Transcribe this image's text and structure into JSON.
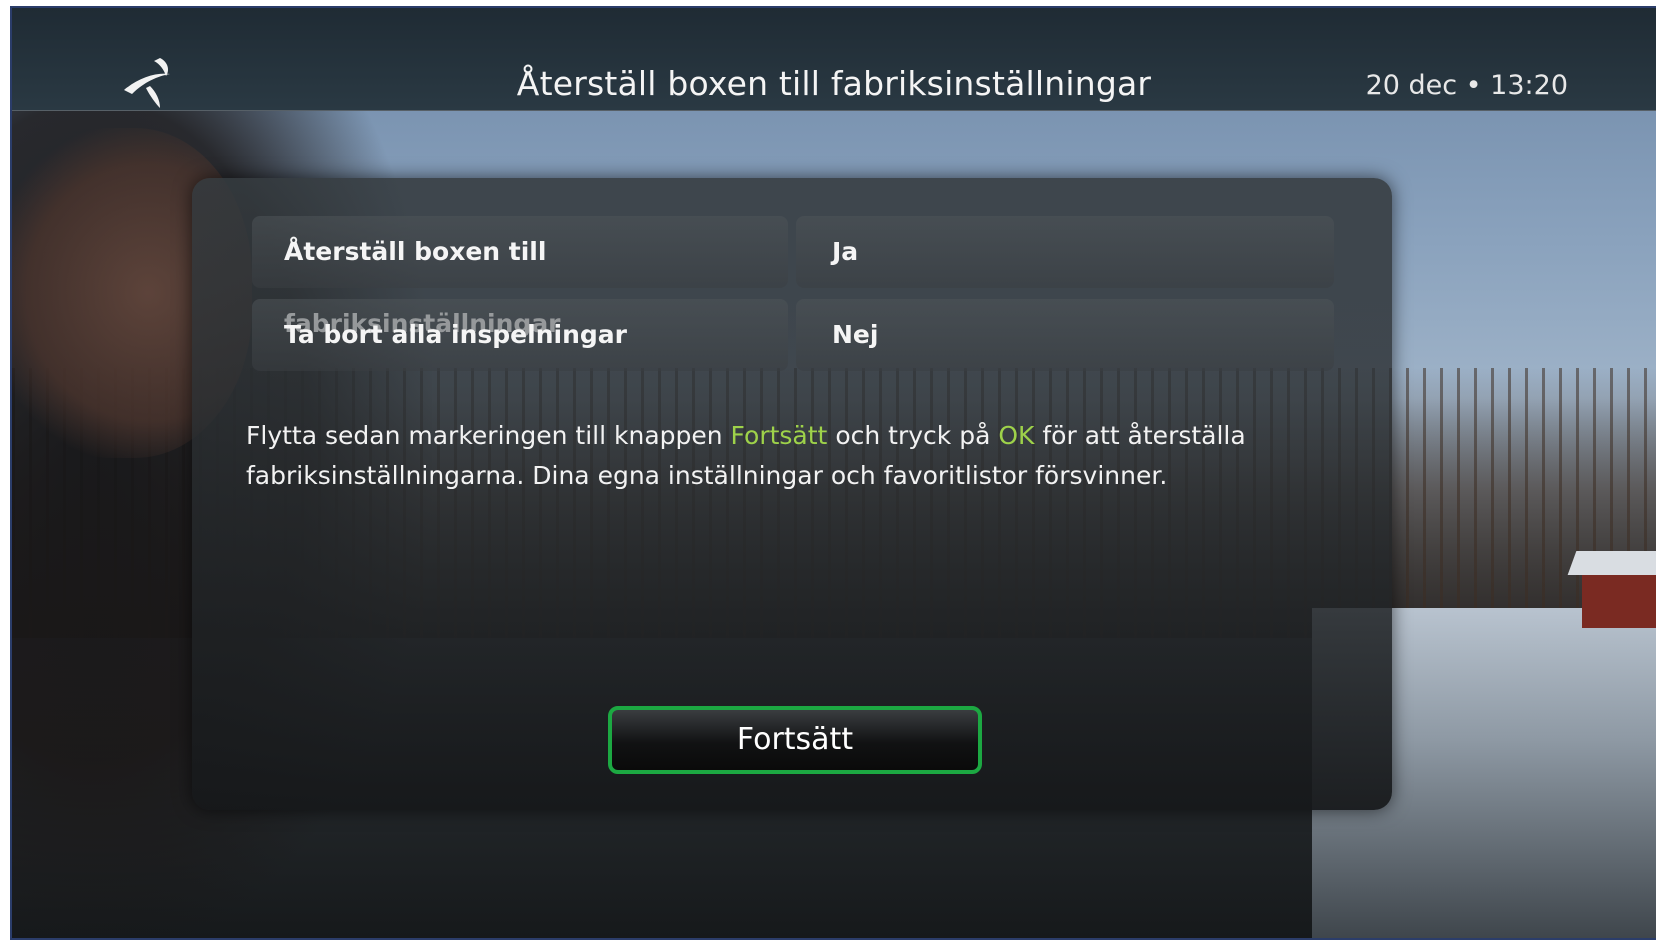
{
  "header": {
    "title": "Återställ boxen till fabriksinställningar",
    "clock": "20 dec • 13:20",
    "logo_icon": "telenor-logo-icon"
  },
  "settings": {
    "rows": [
      {
        "label": "Återställ boxen till fabriksinställningar",
        "value": "Ja"
      },
      {
        "label": "Ta bort alla inspelningar",
        "value": "Nej"
      }
    ]
  },
  "info": {
    "part1": "Flytta sedan markeringen till knappen ",
    "highlight1": "Fortsätt",
    "part2": " och tryck på ",
    "highlight2": "OK",
    "part3": " för att återställa fabriksinställningarna. Dina egna inställningar och favoritlistor försvinner."
  },
  "buttons": {
    "continue_label": "Fortsätt"
  },
  "colors": {
    "highlight_text": "#9ed24a",
    "focus_border": "#1ca842"
  }
}
